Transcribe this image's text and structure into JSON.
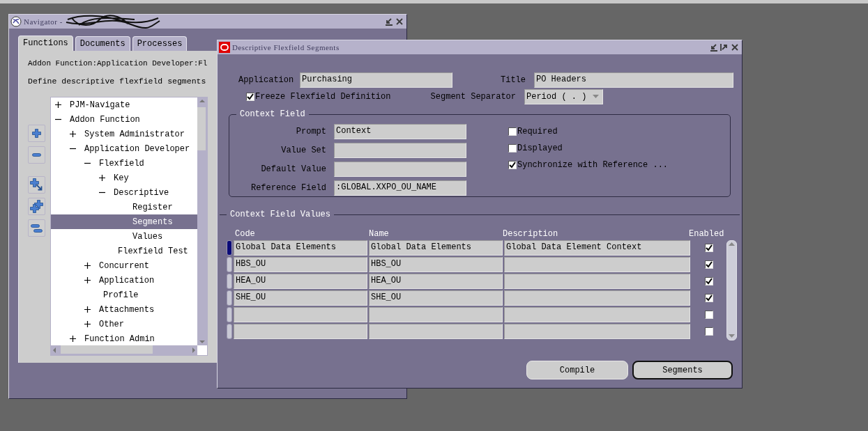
{
  "navigator": {
    "title": "Navigator -",
    "tabs": [
      {
        "label": "Functions",
        "selected": true
      },
      {
        "label": "Documents",
        "selected": false
      },
      {
        "label": "Processes",
        "selected": false
      }
    ],
    "path": "Addon Function:Application Developer:Fl",
    "description": "Define descriptive flexfield segments",
    "tree": [
      {
        "label": "PJM-Navigate",
        "expanded": false,
        "selected": false
      },
      {
        "label": "Addon Function",
        "expanded": true,
        "selected": false,
        "children": [
          {
            "label": "System Administrator",
            "expanded": false,
            "selected": false
          },
          {
            "label": "Application Developer",
            "expanded": true,
            "selected": false,
            "children": [
              {
                "label": "Flexfield",
                "expanded": true,
                "selected": false,
                "children": [
                  {
                    "label": "Key",
                    "expanded": false,
                    "selected": false
                  },
                  {
                    "label": "Descriptive",
                    "expanded": true,
                    "selected": false,
                    "children": [
                      {
                        "label": "Register",
                        "selected": false
                      },
                      {
                        "label": "Segments",
                        "selected": true
                      },
                      {
                        "label": "Values",
                        "selected": false
                      }
                    ]
                  },
                  {
                    "label": "Flexfield Test",
                    "selected": false
                  }
                ]
              },
              {
                "label": "Concurrent",
                "expanded": false,
                "selected": false
              },
              {
                "label": "Application",
                "expanded": false,
                "selected": false
              },
              {
                "label": "Profile",
                "selected": false
              },
              {
                "label": "Attachments",
                "expanded": false,
                "selected": false
              },
              {
                "label": "Other",
                "expanded": false,
                "selected": false
              }
            ]
          },
          {
            "label": "Function Admin",
            "expanded": false,
            "selected": false
          }
        ]
      }
    ]
  },
  "dialog": {
    "title": "Descriptive Flexfield Segments",
    "application": {
      "label": "Application",
      "value": "Purchasing"
    },
    "title_field": {
      "label": "Title",
      "value": "PO Headers"
    },
    "freeze": {
      "label": "Freeze Flexfield Definition",
      "checked": true
    },
    "separator": {
      "label": "Segment Separator",
      "value": "Period ( . )"
    },
    "context_field": {
      "legend": "Context Field",
      "fields": [
        {
          "label": "Prompt",
          "value": "Context"
        },
        {
          "label": "Value Set"
        },
        {
          "label": "Default Value"
        },
        {
          "label": "Reference Field",
          "value": ":GLOBAL.XXPO_OU_NAME"
        }
      ],
      "options": [
        {
          "label": "Required",
          "checked": false
        },
        {
          "label": "Displayed",
          "checked": false
        },
        {
          "label": "Synchronize with Reference ...",
          "checked": true
        }
      ]
    },
    "values": {
      "legend": "Context Field Values",
      "columns": [
        "Code",
        "Name",
        "Description",
        "Enabled"
      ],
      "rows": [
        {
          "code": "Global Data Elements",
          "name": "Global Data Elements",
          "description": "Global Data Element Context",
          "enabled": true,
          "current": true
        },
        {
          "code": "HBS_OU",
          "name": "HBS_OU",
          "enabled": true,
          "current": false
        },
        {
          "code": "HEA_OU",
          "name": "HEA_OU",
          "enabled": true,
          "current": false
        },
        {
          "code": "SHE_OU",
          "name": "SHE_OU",
          "enabled": true,
          "current": false
        },
        {
          "enabled": false,
          "current": false
        },
        {
          "enabled": false,
          "current": false
        }
      ]
    },
    "buttons": [
      {
        "label": "Compile",
        "default": false
      },
      {
        "label": "Segments",
        "default": true
      }
    ]
  }
}
